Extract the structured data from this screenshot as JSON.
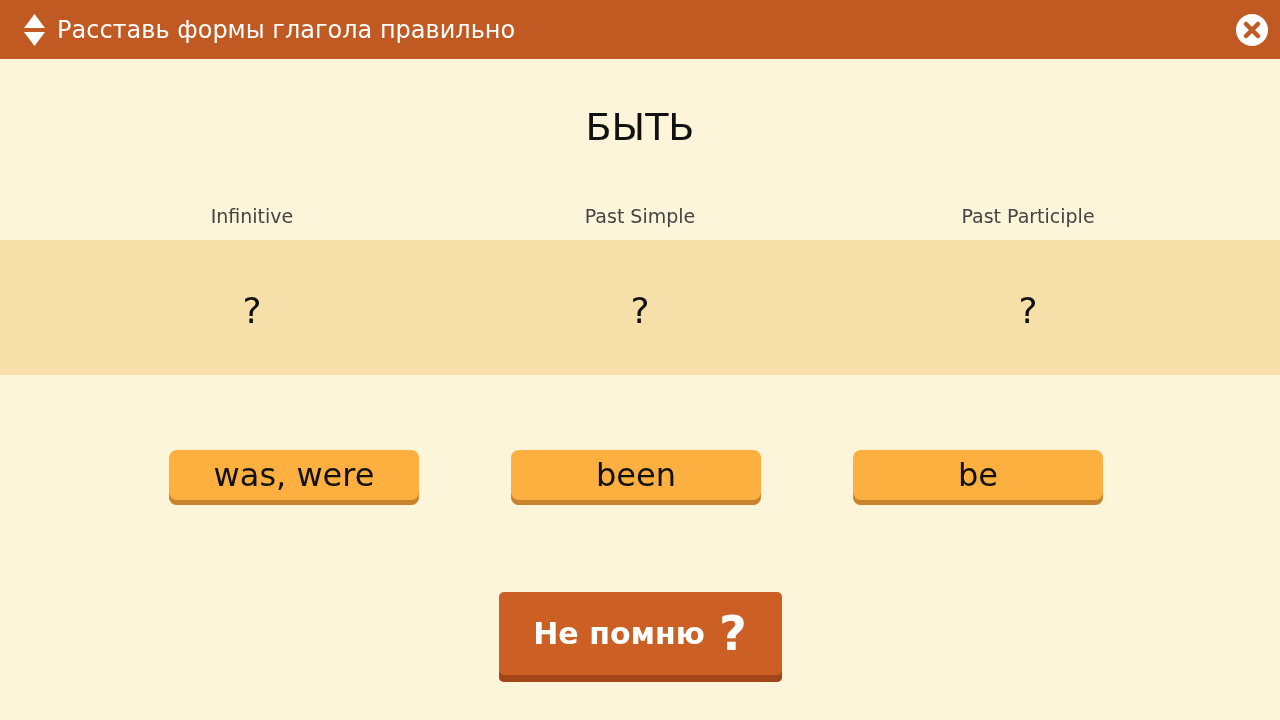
{
  "header": {
    "title": "Расставь формы глагола правильно"
  },
  "verb": "БЫТЬ",
  "columns": [
    {
      "heading": "Infinitive",
      "answer": "?"
    },
    {
      "heading": "Past Simple",
      "answer": "?"
    },
    {
      "heading": "Past Participle",
      "answer": "?"
    }
  ],
  "options": [
    "was, were",
    "been",
    "be"
  ],
  "hint_button": {
    "label": "Не помню",
    "mark": "?"
  }
}
